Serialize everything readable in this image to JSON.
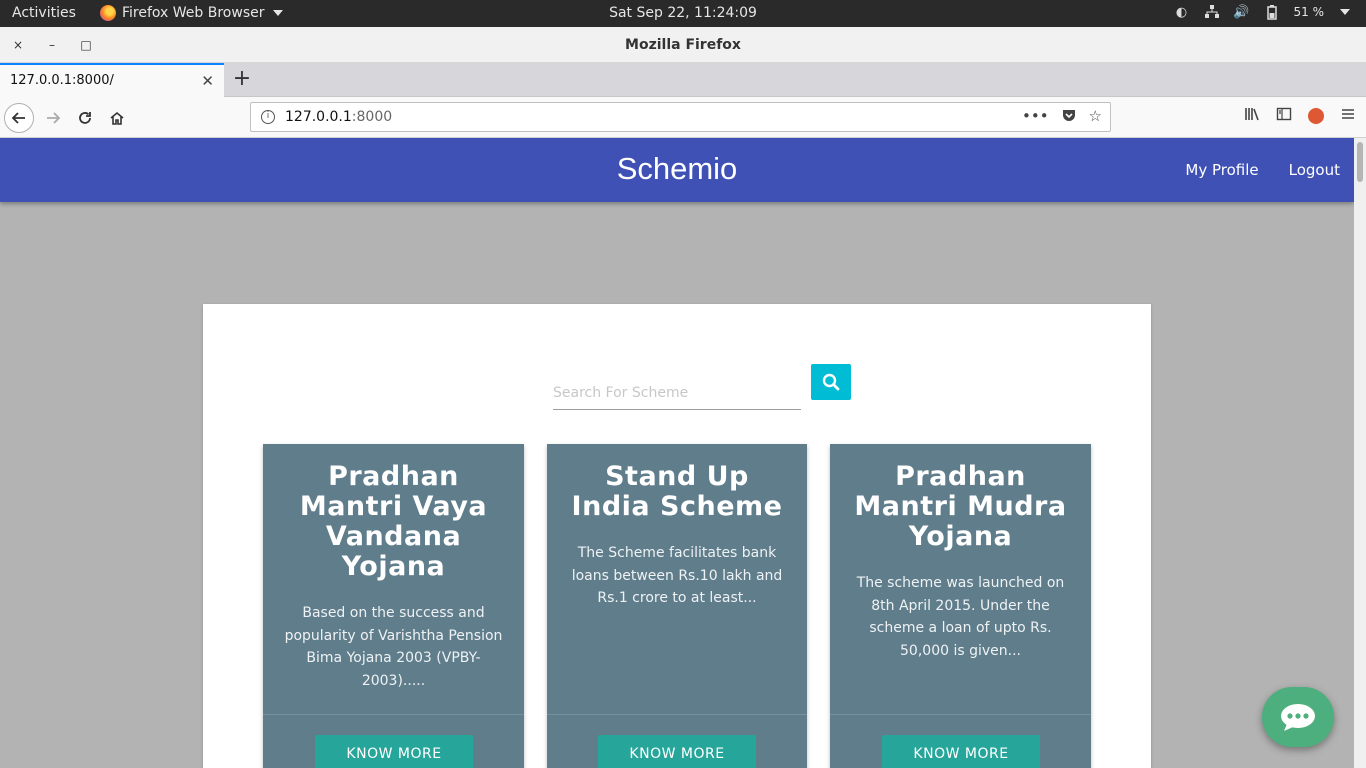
{
  "system_bar": {
    "activities": "Activities",
    "app_name": "Firefox Web Browser",
    "clock": "Sat Sep 22, 11:24:09",
    "battery": "51 %"
  },
  "window": {
    "title": "Mozilla Firefox",
    "close": "×",
    "minimize": "–",
    "maximize": "□"
  },
  "tabs": [
    {
      "label": "127.0.0.1:8000/",
      "active": true
    }
  ],
  "toolbar": {
    "url_host": "127.0.0.1",
    "url_port": ":8000",
    "page_actions": "•••"
  },
  "page": {
    "brand": "Schemio",
    "nav": {
      "profile": "My Profile",
      "logout": "Logout"
    },
    "search": {
      "placeholder": "Search For Scheme",
      "value": ""
    },
    "cards": [
      {
        "title": "Pradhan Mantri Vaya Vandana Yojana",
        "description": "Based on the success and popularity of Varishtha Pension Bima Yojana 2003 (VPBY-2003).....",
        "button": "KNOW MORE"
      },
      {
        "title": "Stand Up India Scheme",
        "description": "The Scheme facilitates bank loans between Rs.10 lakh and Rs.1 crore to at least...",
        "button": "KNOW MORE"
      },
      {
        "title": "Pradhan Mantri Mudra Yojana",
        "description": "The scheme was launched on 8th April 2015. Under the scheme a loan of upto Rs. 50,000 is given...",
        "button": "KNOW MORE"
      }
    ]
  },
  "colors": {
    "header": "#3f51b5",
    "card": "#607d8b",
    "button": "#26a69a",
    "search_button": "#00bcd4",
    "chat_button": "#4caf7d"
  }
}
